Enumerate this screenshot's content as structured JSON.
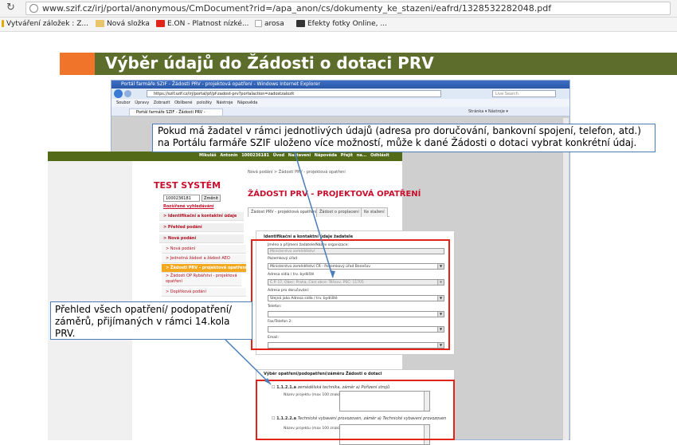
{
  "browser": {
    "url": "www.szif.cz/irj/portal/anonymous/CmDocument?rid=/apa_anon/cs/dokumenty_ke_stazeni/eafrd/1328532282048.pdf",
    "bookmarks": [
      {
        "label": "Vytváření záložek : Z...",
        "icon": "bookmark-icon",
        "color": "#e6a800"
      },
      {
        "label": "Nová složka",
        "icon": "folder-icon",
        "color": "#e8c56a"
      },
      {
        "label": "E.ON - Platnost nízké...",
        "icon": "eon-icon",
        "color": "#e2231a"
      },
      {
        "label": "arosa",
        "icon": "page-icon",
        "color": "#cccccc"
      },
      {
        "label": "Efekty fotky Online, ...",
        "icon": "photo-icon",
        "color": "#333333"
      }
    ]
  },
  "slide": {
    "title": "Výběr údajů do Žádosti o dotaci PRV",
    "title_bar_color": "#5d6e2c",
    "accent_color": "#f0742a"
  },
  "ie": {
    "title": "Portál farmáře SZIF - Žádosti PRV - projektová opatření - Windows Internet Explorer",
    "url": "https://szif.szif.cz/irj/portal/pf/pf-zadost-prv?portalaction=zadostzalozit",
    "search_placeholder": "Live Search",
    "menu": "Soubor Úpravy Zobrazit Oblíbené položky Nástroje Nápověda",
    "tab": "Portál farmáře SZIF - Žádosti PRV - projektová opatření",
    "tools": "Stránka ▾  Nástroje ▾"
  },
  "portal": {
    "topnav": "Mikuláš Antonín   1000236181   Úvod   Nastavení   Nápověda   Přejít na...   Odhlásit",
    "system_title": "TEST SYSTÉM",
    "id_value": "1000236181",
    "change_button": "Změnit",
    "extended_search": "Rozšířené vyhledávání",
    "left_nav": [
      {
        "label": "> Identifikační a kontaktní údaje",
        "style": "bold"
      },
      {
        "label": "> Přehled podání",
        "style": "bold"
      },
      {
        "label": "> Nová podání",
        "style": "bold"
      },
      {
        "label": "> Nová podání",
        "style": "normal"
      },
      {
        "label": "> Jednotná žádost a žádost AEO",
        "style": "normal"
      },
      {
        "label": "> Žádosti PRV - projektová opatření",
        "style": "sel"
      },
      {
        "label": "> Žádosti OP Rybářství - projektová opatření",
        "style": "normal"
      },
      {
        "label": "> Doplňková podání",
        "style": "normal"
      }
    ],
    "breadcrumb": "Nová podání > Žádosti PRV - projektová opatření",
    "page_heading": "ŽÁDOSTI PRV - PROJEKTOVÁ OPATŘENÍ",
    "tabs": [
      "Žádost PRV - projektová opatření",
      "Žádost o proplacení",
      "Ke stažení"
    ],
    "form_section_title": "Identifikační a kontaktní údaje žadatele",
    "fields": [
      {
        "label": "Jméno a příjmení žadatele/Název organizace:",
        "value": "Ministerstvo zemědělství",
        "gray": true
      },
      {
        "label": "Pozemkový úřad",
        "value": "Ministerstvo zemědělství ČR - Pozemkový úřad Benešov",
        "gray": false
      },
      {
        "label": "Adresa sídla / trv. bydliště",
        "value": "Č.P. 17, Obec: Praha, Část obce: Těšnov, PSČ: 11705",
        "gray": true
      },
      {
        "label": "Adresa pro doručování:",
        "value": "Stejná jako Adresa sídla / trv. bydliště",
        "gray": false
      },
      {
        "label": "Telefon:",
        "value": "",
        "gray": false
      },
      {
        "label": "Fax/Telefon 2:",
        "value": "",
        "gray": false
      },
      {
        "label": "Email:",
        "value": "",
        "gray": false
      }
    ],
    "measures_title": "Výběr opatření/podopatření/záměru Žádosti o dotaci",
    "measures": [
      {
        "code": "1.1.2.1.a",
        "name": "zemědělská technika, záměr a) Pořízení strojů",
        "sub": "Název projektu (max 100 znaků):"
      },
      {
        "code": "1.1.2.2.a",
        "name": "Technické vybavení provozoven, záměr a) Technické vybavení provozoven",
        "sub": "Název projektu (max 100 znaků):"
      }
    ]
  },
  "callouts": {
    "top": "Pokud má žadatel v rámci jednotlivých údajů (adresa pro doručování, bankovní spojení, telefon, atd.) na Portálu farmáře SZIF uloženo více možností, může k dané Žádosti o dotaci vybrat konkrétní údaj.",
    "bottom": "Přehled všech opatření/ podopatření/ záměrů, přijímaných v rámci 14.kola PRV.",
    "border_color": "#4a7ebb"
  }
}
